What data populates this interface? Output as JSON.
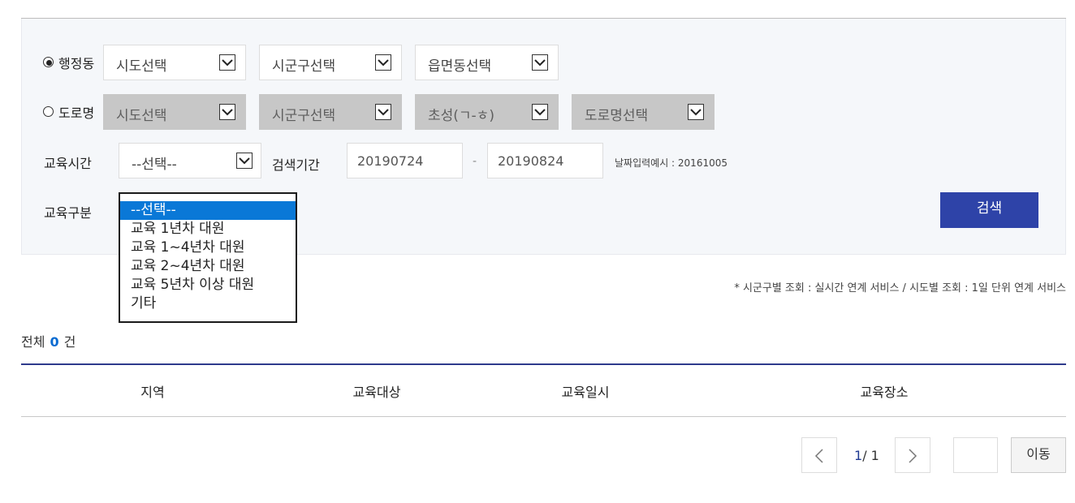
{
  "filters": {
    "admin": {
      "label": "행정동",
      "selected": true,
      "province": "시도선택",
      "district": "시군구선택",
      "town": "읍면동선택"
    },
    "road": {
      "label": "도로명",
      "selected": false,
      "province": "시도선택",
      "district": "시군구선택",
      "initial": "초성(ㄱ-ㅎ)",
      "road_name": "도로명선택"
    },
    "edu_time": {
      "label": "교육시간",
      "value": "--선택--"
    },
    "period": {
      "label": "검색기간",
      "start": "20190724",
      "separator": "-",
      "end": "20190824",
      "hint": "날짜입력예시 : 20161005"
    },
    "edu_type": {
      "label": "교육구분",
      "options": [
        "--선택--",
        "교육 1년차 대원",
        "교육 1~4년차 대원",
        "교육 2~4년차 대원",
        "교육 5년차 이상 대원",
        "기타"
      ],
      "highlighted_index": 0
    },
    "search_button": "검색"
  },
  "notice": "* 시군구별 조회 : 실시간 연계 서비스 / 시도별 조회 : 1일 단위 연계 서비스",
  "summary": {
    "prefix": "전체",
    "count": "0",
    "suffix": "건"
  },
  "table": {
    "headers": [
      "지역",
      "교육대상",
      "교육일시",
      "교육장소"
    ]
  },
  "pagination": {
    "prev_icon": "chevron-left-icon",
    "next_icon": "chevron-right-icon",
    "current": "1",
    "total": "/ 1",
    "page_input": "",
    "go_label": "이동"
  },
  "colors": {
    "primary": "#2e43a8",
    "highlight": "#0a78d7",
    "count": "#0a6bd1",
    "disabled": "#c7c7c7"
  }
}
